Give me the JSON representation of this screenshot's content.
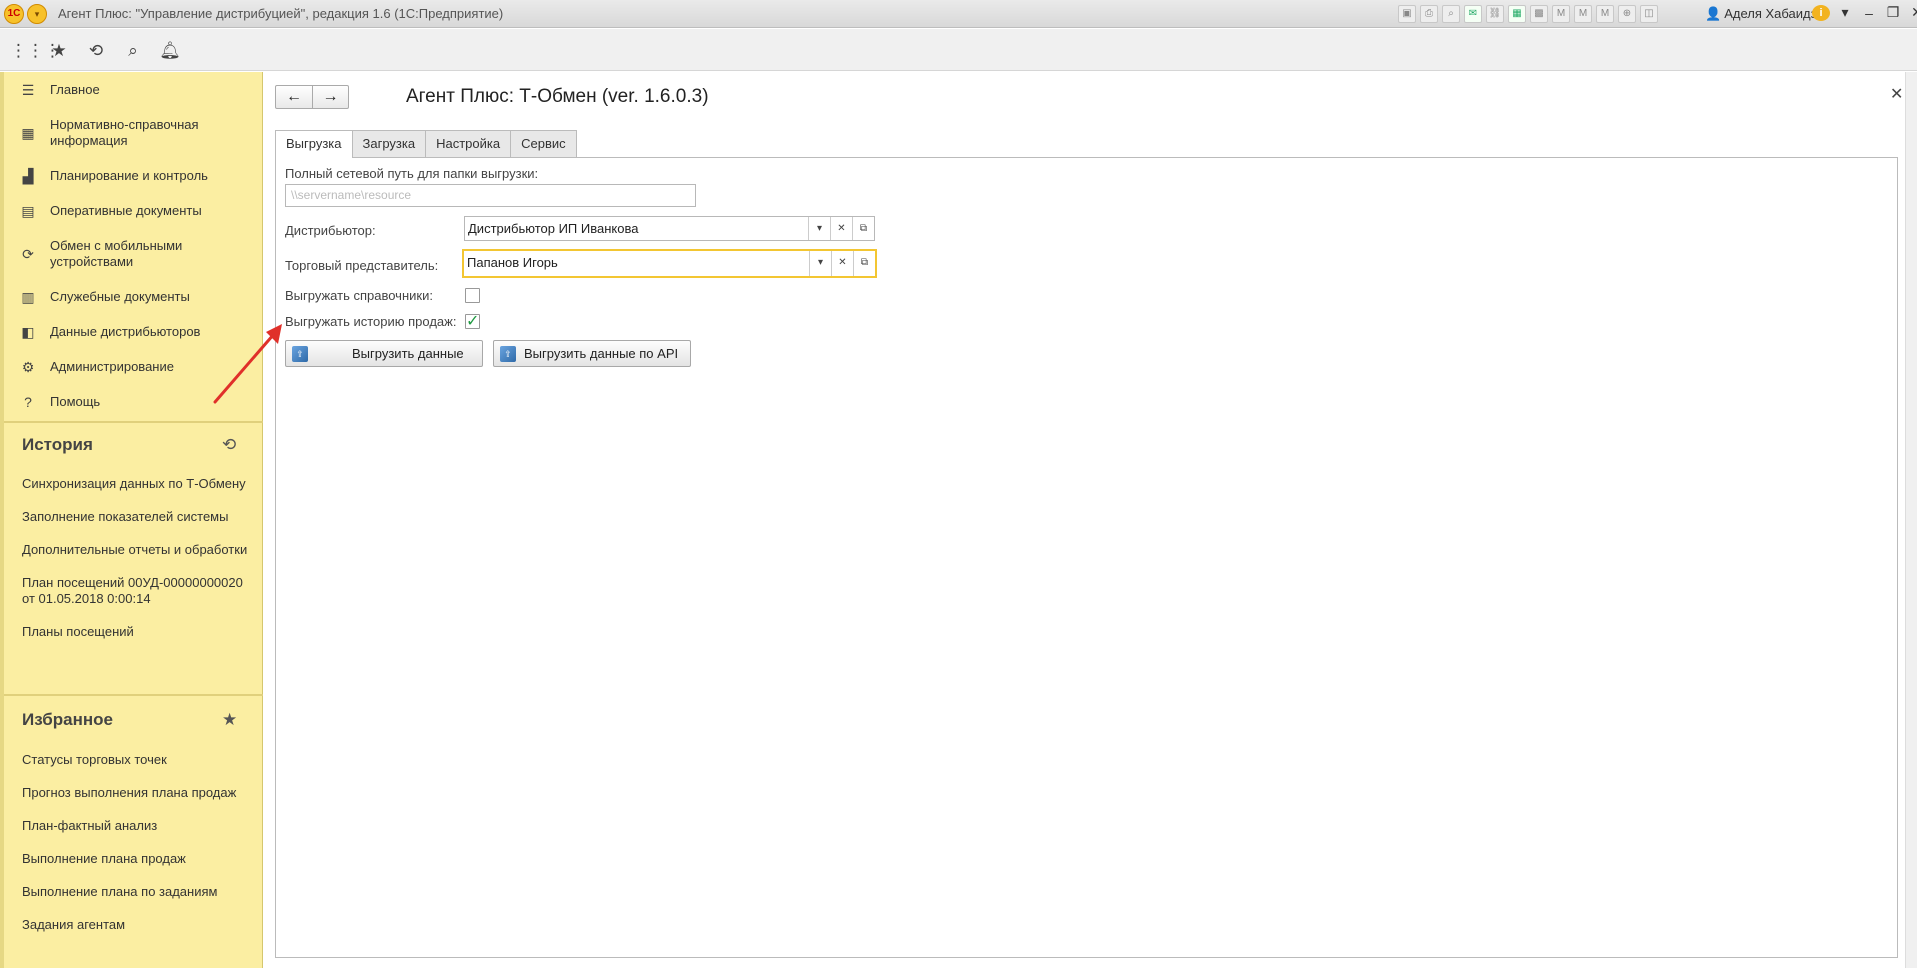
{
  "window": {
    "title": "Агент Плюс: \"Управление дистрибуцией\", редакция 1.6  (1С:Предприятие)",
    "user": "Аделя Хабаидзе",
    "logo_text": "1C"
  },
  "sidebar": {
    "nav": [
      {
        "label": "Главное",
        "icon": "☰"
      },
      {
        "label": "Нормативно-справочная информация",
        "icon": "▦"
      },
      {
        "label": "Планирование и контроль",
        "icon": "▟"
      },
      {
        "label": "Оперативные документы",
        "icon": "▤"
      },
      {
        "label": "Обмен с мобильными устройствами",
        "icon": "⟳"
      },
      {
        "label": "Служебные документы",
        "icon": "▥"
      },
      {
        "label": "Данные дистрибьюторов",
        "icon": "◧"
      },
      {
        "label": "Администрирование",
        "icon": "⚙"
      },
      {
        "label": "Помощь",
        "icon": "?"
      }
    ],
    "history": {
      "title": "История",
      "items": [
        "Синхронизация данных по Т-Обмену",
        "Заполнение показателей системы",
        "Дополнительные отчеты и обработки",
        "План посещений 00УД-00000000020 от 01.05.2018 0:00:14",
        "Планы посещений"
      ]
    },
    "favorites": {
      "title": "Избранное",
      "items": [
        "Статусы торговых точек",
        "Прогноз выполнения плана продаж",
        "План-фактный анализ",
        "Выполнение плана продаж",
        "Выполнение плана по заданиям",
        "Задания агентам"
      ]
    }
  },
  "form": {
    "title": "Агент Плюс: Т-Обмен (ver. 1.6.0.3)",
    "tabs": [
      "Выгрузка",
      "Загрузка",
      "Настройка",
      "Сервис"
    ],
    "active_tab": "Выгрузка",
    "path_label": "Полный сетевой путь для папки выгрузки:",
    "path_placeholder": "\\\\servername\\resource",
    "distributor_label": "Дистрибьютор:",
    "distributor_value": "Дистрибьютор ИП Иванкова",
    "agent_label": "Торговый представитель:",
    "agent_value": "Папанов Игорь",
    "export_refs_label": "Выгружать справочники:",
    "export_refs_checked": false,
    "export_history_label": "Выгружать историю продаж:",
    "export_history_checked": true,
    "btn_export": "Выгрузить данные",
    "btn_export_api": "Выгрузить данные по API"
  },
  "colors": {
    "sidebar_bg": "#fbeea2",
    "focus_border": "#f3c632",
    "check_green": "#1f9a42",
    "annotation_arrow": "#e0302a"
  }
}
